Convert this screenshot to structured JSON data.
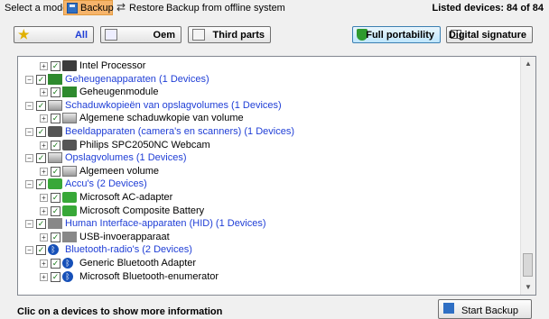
{
  "modebar": {
    "select_mode_label": "Select a mode",
    "backup_label": "Backup",
    "restore_label": "Restore",
    "offline_label": "Backup from offline system",
    "listed_devices": "Listed devices: 84 of 84"
  },
  "filters": {
    "all": "All",
    "oem": "Oem",
    "third_parts": "Third parts",
    "full_portability": "Full portability",
    "digital_signature": "Digital signature"
  },
  "tree": {
    "rows": [
      {
        "label": "Intel Processor",
        "kind": "device",
        "icon": "chip-icon"
      },
      {
        "label": "Geheugenapparaten   (1 Devices)",
        "kind": "category",
        "icon": "memory-icon"
      },
      {
        "label": "Geheugenmodule",
        "kind": "device",
        "icon": "memory-icon"
      },
      {
        "label": "Schaduwkopieën van opslagvolumes   (1 Devices)",
        "kind": "category",
        "icon": "disk-icon"
      },
      {
        "label": "Algemene schaduwkopie van volume",
        "kind": "device",
        "icon": "disk-icon"
      },
      {
        "label": "Beeldapparaten (camera's en scanners)   (1 Devices)",
        "kind": "category",
        "icon": "camera-icon"
      },
      {
        "label": "Philips SPC2050NC Webcam",
        "kind": "device",
        "icon": "camera-icon"
      },
      {
        "label": "Opslagvolumes   (1 Devices)",
        "kind": "category",
        "icon": "disk-icon"
      },
      {
        "label": "Algemeen volume",
        "kind": "device",
        "icon": "disk-icon"
      },
      {
        "label": "Accu's   (2 Devices)",
        "kind": "category",
        "icon": "battery-icon"
      },
      {
        "label": "Microsoft AC-adapter",
        "kind": "device",
        "icon": "battery-icon"
      },
      {
        "label": "Microsoft Composite Battery",
        "kind": "device",
        "icon": "battery-icon"
      },
      {
        "label": "Human Interface-apparaten (HID)   (1 Devices)",
        "kind": "category",
        "icon": "usb-icon"
      },
      {
        "label": "USB-invoerapparaat",
        "kind": "device",
        "icon": "usb-icon"
      },
      {
        "label": "Bluetooth-radio's   (2 Devices)",
        "kind": "category",
        "icon": "bluetooth-icon"
      },
      {
        "label": "Generic Bluetooth Adapter",
        "kind": "device",
        "icon": "bluetooth-icon"
      },
      {
        "label": "Microsoft Bluetooth-enumerator",
        "kind": "device",
        "icon": "bluetooth-icon"
      }
    ]
  },
  "footer": {
    "info_text": "Clic on a devices to show more information",
    "start_backup": "Start Backup"
  }
}
